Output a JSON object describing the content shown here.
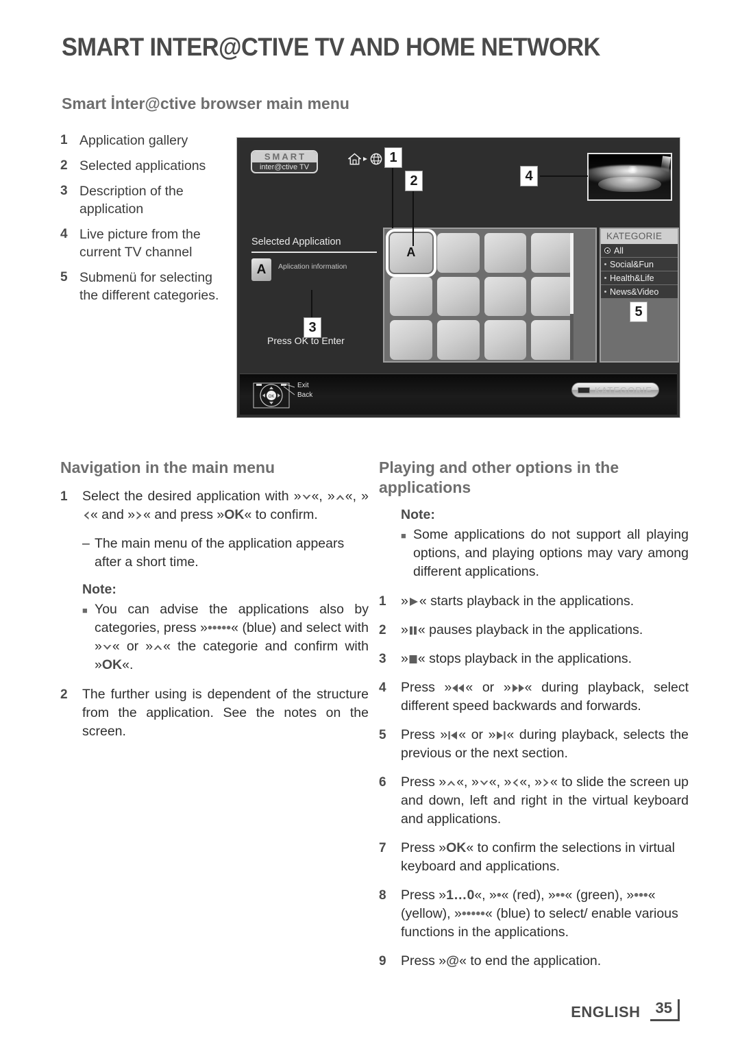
{
  "header": {
    "chapter_title": "SMART INTER@CTIVE TV AND HOME NETWORK",
    "section_title": "Smart İnter@ctive browser main menu"
  },
  "legend": {
    "items": [
      {
        "num": "1",
        "text": "Application gallery"
      },
      {
        "num": "2",
        "text": "Selected applications"
      },
      {
        "num": "3",
        "text": "Description of the application"
      },
      {
        "num": "4",
        "text": "Live picture from the current TV channel"
      },
      {
        "num": "5",
        "text": "Submenü for selecting the different categories."
      }
    ]
  },
  "tv_screenshot": {
    "logo_top": "SMART",
    "logo_bottom": "inter@ctive TV",
    "nav_icons": [
      "home-icon",
      "arrow-right-icon",
      "globe-icon"
    ],
    "callouts": [
      "1",
      "2",
      "3",
      "4",
      "5"
    ],
    "selected_application_title": "Selected Application",
    "selected_application_tile": "A",
    "selected_application_info": "Aplication information",
    "press_ok": "Press OK to Enter",
    "grid": {
      "rows": 3,
      "columns": 4,
      "selected_tile_label": "A"
    },
    "category_panel": {
      "header": "KATEGORIE",
      "items": [
        {
          "label": "All",
          "selected": true
        },
        {
          "label": "Social&Fun",
          "selected": false
        },
        {
          "label": "Health&Life",
          "selected": false
        },
        {
          "label": "News&Video",
          "selected": false
        }
      ]
    },
    "bottom_bar": {
      "exit_label": "Exit",
      "back_label": "Back",
      "ok_label": "OK",
      "kategorie_button": "KATEGORIE"
    }
  },
  "left_column": {
    "heading": "Navigation in the main menu",
    "item1": {
      "num": "1",
      "part_a": "Select the desired application with »",
      "part_b": "«, »",
      "part_c": "«, »",
      "part_d": "« and »",
      "part_e": "« and press »",
      "ok": "OK",
      "part_f": "« to confirm."
    },
    "sub1": {
      "dash": "–",
      "text": "The main menu of the application appears after a short time."
    },
    "note": {
      "label": "Note:",
      "bullet": "■",
      "part_a": "You can advise the applications also by categories, press »",
      "blue_dots": "•••••",
      "part_b": "« (blue) and select with »",
      "part_c": "« or »",
      "part_d": "« the categorie and confirm with »",
      "ok": "OK",
      "part_e": "«."
    },
    "item2": {
      "num": "2",
      "text": "The further using is dependent of the structure from the application. See the notes on the screen."
    }
  },
  "right_column": {
    "heading": "Playing and other options in the applications",
    "note": {
      "label": "Note:",
      "bullet": "■",
      "text": "Some applications do not support all playing options, and playing options may vary among different applications."
    },
    "items": [
      {
        "num": "1",
        "pre": "»",
        "icon": "play-icon",
        "post": "« starts playback in the applications."
      },
      {
        "num": "2",
        "pre": "»",
        "icon": "pause-icon",
        "post": "« pauses playback in the applications."
      },
      {
        "num": "3",
        "pre": "»",
        "icon": "stop-icon",
        "post": "« stops playback in the applications."
      },
      {
        "num": "4",
        "pre": "Press »",
        "icon": "rewind-icon",
        "mid": "« or »",
        "icon2": "fast-forward-icon",
        "post": "« during playback, select different speed backwards and forwards."
      },
      {
        "num": "5",
        "pre": "Press »",
        "icon": "previous-section-icon",
        "mid": "« or »",
        "icon2": "next-section-icon",
        "post": "« during playback, selects the previous or the next section."
      },
      {
        "num": "6",
        "pre": "Press »",
        "icon": "up-arrow-icon",
        "mid": "«, »",
        "icon2": "down-arrow-icon",
        "mid2": "«, »",
        "icon3": "left-arrow-icon",
        "mid3": "«, »",
        "icon4": "right-arrow-icon",
        "post": "« to slide the screen up and down, left and right in the virtual keyboard and applications."
      },
      {
        "num": "7",
        "pre": "Press »",
        "ok": "OK",
        "post": "« to confirm the selections in virtual keyboard and applications."
      },
      {
        "num": "8",
        "pre": "Press »",
        "keys": "1…0",
        "p1": "«, »",
        "red": "•",
        "p2": "« (red), »",
        "green": "••",
        "p3": "« (green), »",
        "yellow": "•••",
        "p4": "« (yellow), »",
        "blue": "•••••",
        "p5": "« (blue) to select/ enable various functions in the applications."
      },
      {
        "num": "9",
        "pre": "Press »",
        "at": "@",
        "post": "« to end the application."
      }
    ]
  },
  "footer": {
    "language": "ENGLISH",
    "page_number": "35"
  },
  "colors": {
    "text": "#2e2e2e",
    "heading": "#6e6e6e",
    "title": "#4a4a4a",
    "tv_bg": "#2e2e2e"
  }
}
